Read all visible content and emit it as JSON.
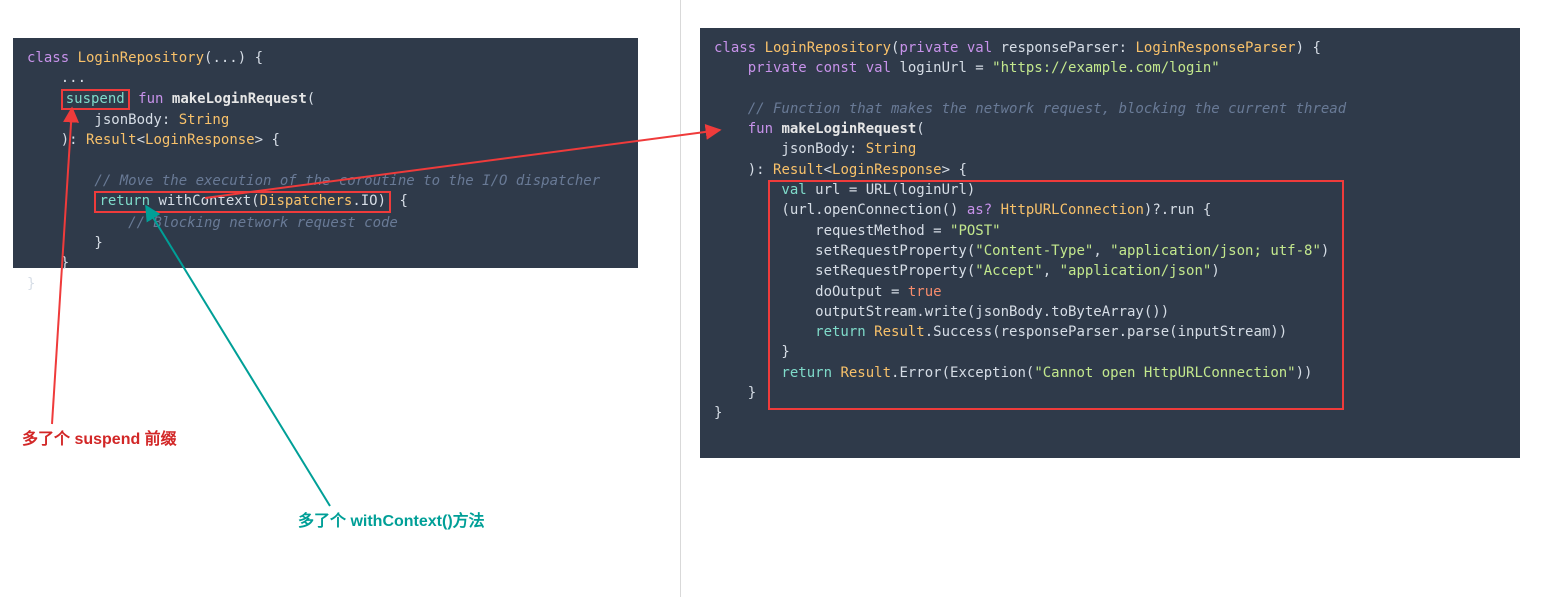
{
  "left_code": {
    "l1": {
      "a": "class ",
      "b": "LoginRepository",
      "c": "(...) {"
    },
    "l2": "    ...",
    "l3": {
      "a": "suspend",
      "b": " fun ",
      "c": "makeLoginRequest",
      "d": "("
    },
    "l4": {
      "a": "        jsonBody: ",
      "b": "String"
    },
    "l5": {
      "a": "    ): ",
      "b": "Result",
      "c": "<",
      "d": "LoginResponse",
      "e": "> {"
    },
    "l6": "",
    "l7": "        // Move the execution of the coroutine to the I/O dispatcher",
    "l8": {
      "a": "return ",
      "b": "withContext(",
      "c": "Dispatchers",
      "d": ".IO)",
      "e": " {"
    },
    "l9": "            // Blocking network request code",
    "l10": "        }",
    "l11": "    }",
    "l12": "}"
  },
  "right_code": {
    "r1": {
      "a": "class ",
      "b": "LoginRepository",
      "c": "(",
      "d": "private val ",
      "e": "responseParser: ",
      "f": "LoginResponseParser",
      "g": ") {"
    },
    "r2": {
      "a": "    private const val ",
      "b": "loginUrl = ",
      "c": "\"https://example.com/login\""
    },
    "r3": "",
    "r4": "    // Function that makes the network request, blocking the current thread",
    "r5": {
      "a": "    fun ",
      "b": "makeLoginRequest",
      "c": "("
    },
    "r6": {
      "a": "        jsonBody: ",
      "b": "String"
    },
    "r7": {
      "a": "    ): ",
      "b": "Result",
      "c": "<",
      "d": "LoginResponse",
      "e": "> {"
    },
    "r8": {
      "a": "        val ",
      "b": "url = URL(loginUrl)"
    },
    "r9": {
      "a": "        (url.openConnection() ",
      "b": "as? ",
      "c": "HttpURLConnection",
      "d": ")?.run {"
    },
    "r10": {
      "a": "            requestMethod = ",
      "b": "\"POST\""
    },
    "r11": {
      "a": "            setRequestProperty(",
      "b": "\"Content-Type\"",
      "c": ", ",
      "d": "\"application/json; utf-8\"",
      "e": ")"
    },
    "r12": {
      "a": "            setRequestProperty(",
      "b": "\"Accept\"",
      "c": ", ",
      "d": "\"application/json\"",
      "e": ")"
    },
    "r13": {
      "a": "            doOutput = ",
      "b": "true"
    },
    "r14": "            outputStream.write(jsonBody.toByteArray())",
    "r15": {
      "a": "            return ",
      "b": "Result",
      "c": ".Success(responseParser.parse(inputStream))"
    },
    "r16": "        }",
    "r17": {
      "a": "        return ",
      "b": "Result",
      "c": ".Error(Exception(",
      "d": "\"Cannot open HttpURLConnection\"",
      "e": "))"
    },
    "r18": "    }",
    "r19": "}"
  },
  "annotations": {
    "suspend_label": "多了个 suspend 前缀",
    "withcontext_label": "多了个 withContext()方法"
  },
  "colors": {
    "red": "#ef3b3b",
    "teal": "#009f97"
  }
}
